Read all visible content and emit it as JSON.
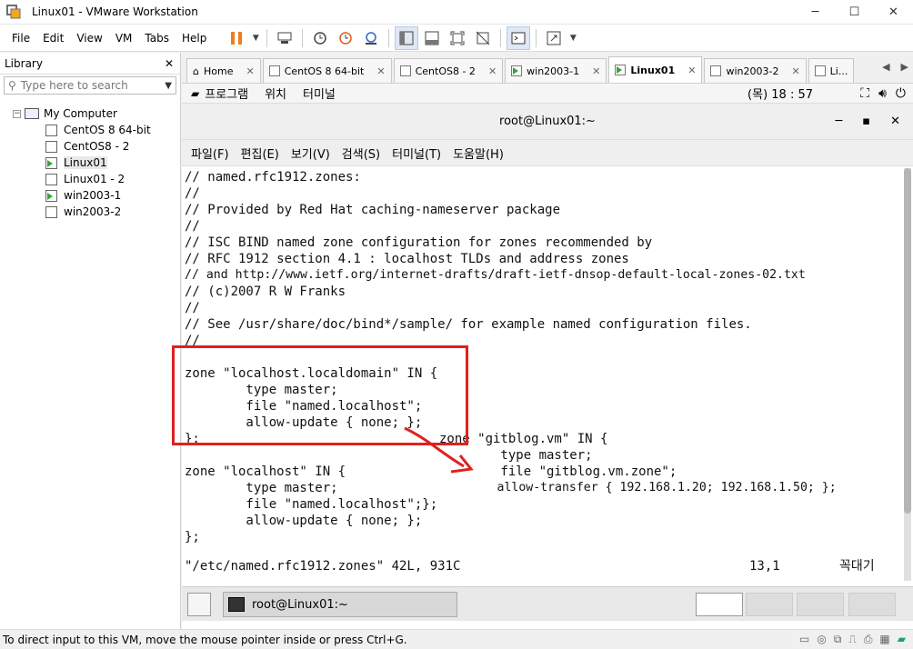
{
  "window": {
    "title": "Linux01 - VMware Workstation"
  },
  "menu": [
    "File",
    "Edit",
    "View",
    "VM",
    "Tabs",
    "Help"
  ],
  "library": {
    "title": "Library",
    "search_placeholder": "Type here to search",
    "root": "My Computer",
    "items": [
      {
        "label": "CentOS 8 64-bit",
        "running": false
      },
      {
        "label": "CentOS8 - 2",
        "running": false
      },
      {
        "label": "Linux01",
        "running": true
      },
      {
        "label": "Linux01 - 2",
        "running": false
      },
      {
        "label": "win2003-1",
        "running": true
      },
      {
        "label": "win2003-2",
        "running": false
      }
    ]
  },
  "tabs": [
    {
      "label": "Home"
    },
    {
      "label": "CentOS 8 64-bit"
    },
    {
      "label": "CentOS8 - 2"
    },
    {
      "label": "win2003-1"
    },
    {
      "label": "Linux01"
    },
    {
      "label": "win2003-2"
    },
    {
      "label": "Li..."
    }
  ],
  "gnome": {
    "apps": "프로그램",
    "places": "위치",
    "terminal": "터미널",
    "clock": "(목) 18 : 57"
  },
  "terminal": {
    "title": "root@Linux01:~",
    "menu": [
      "파일(F)",
      "편집(E)",
      "보기(V)",
      "검색(S)",
      "터미널(T)",
      "도움말(H)"
    ],
    "lines": [
      "// named.rfc1912.zones:",
      "//",
      "// Provided by Red Hat caching-nameserver package",
      "//",
      "// ISC BIND named zone configuration for zones recommended by",
      "// RFC 1912 section 4.1 : localhost TLDs and address zones",
      "// and http://www.ietf.org/internet-drafts/draft-ietf-dnsop-default-local-zones-02.txt",
      "// (c)2007 R W Franks",
      "//",
      "// See /usr/share/doc/bind*/sample/ for example named configuration files.",
      "//",
      "",
      "zone \"localhost.localdomain\" IN {",
      "        type master;",
      "        file \"named.localhost\";",
      "        allow-update { none; };",
      "};",
      "",
      "zone \"localhost\" IN {",
      "        type master;",
      "        file \"named.localhost\";};",
      "        allow-update { none; };",
      "};"
    ],
    "overlay_lines": [
      "zone \"gitblog.vm\" IN {",
      "        type master;",
      "        file \"gitblog.vm.zone\";",
      "        allow-transfer { 192.168.1.20; 192.168.1.50; };"
    ],
    "status_file": "\"/etc/named.rfc1912.zones\" 42L, 931C",
    "status_pos": "13,1",
    "status_where": "꼭대기"
  },
  "vm_taskbar": {
    "task": "root@Linux01:~"
  },
  "statusbar": {
    "text": "To direct input to this VM, move the mouse pointer inside or press Ctrl+G."
  },
  "colors": {
    "annotation": "#e02020",
    "run_indicator": "#3aa23a",
    "pause": "#f07e1b"
  }
}
